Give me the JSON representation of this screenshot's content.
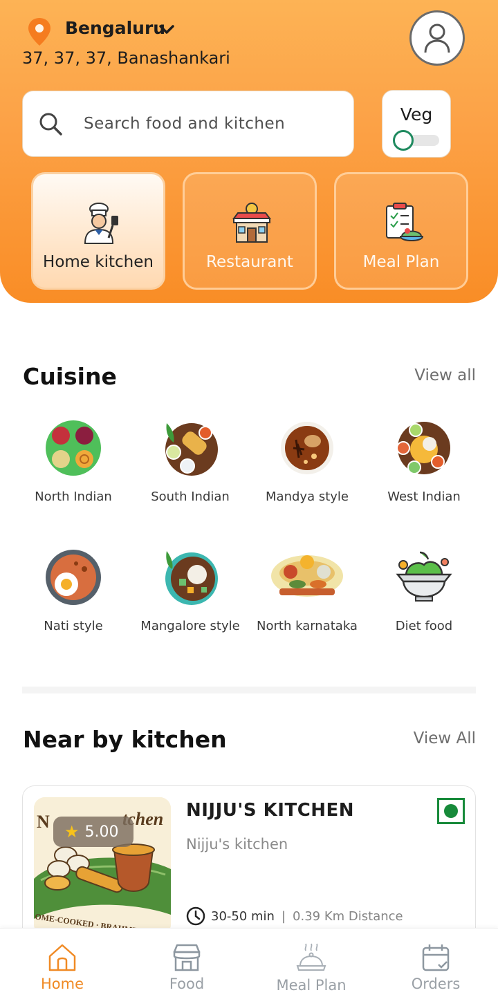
{
  "location": {
    "city": "Bengaluru",
    "address": "37, 37, 37, Banashankari"
  },
  "search": {
    "placeholder": "Search food and kitchen"
  },
  "veg_toggle": {
    "label": "Veg",
    "on": false
  },
  "categories": [
    {
      "label": "Home kitchen",
      "icon": "chef-icon",
      "active": true
    },
    {
      "label": "Restaurant",
      "icon": "restaurant-icon",
      "active": false
    },
    {
      "label": "Meal Plan",
      "icon": "meal-plan-icon",
      "active": false
    }
  ],
  "cuisine": {
    "title": "Cuisine",
    "view_all": "View all",
    "items": [
      {
        "label": "North Indian"
      },
      {
        "label": "South Indian"
      },
      {
        "label": "Mandya style"
      },
      {
        "label": "West Indian"
      },
      {
        "label": "Nati style"
      },
      {
        "label": "Mangalore style"
      },
      {
        "label": "North karnataka"
      },
      {
        "label": "Diet food"
      }
    ]
  },
  "nearby": {
    "title": "Near by kitchen",
    "view_all": "View All",
    "kitchens": [
      {
        "name": "NIJJU'S KITCHEN",
        "subtitle": "Nijju's kitchen",
        "rating": "5.00",
        "time": "30-50 min",
        "distance": "0.39 Km Distance",
        "veg": true
      }
    ]
  },
  "bottom_nav": [
    {
      "label": "Home",
      "icon": "home-icon",
      "active": true
    },
    {
      "label": "Food",
      "icon": "store-icon",
      "active": false
    },
    {
      "label": "Meal Plan",
      "icon": "cloche-icon",
      "active": false
    },
    {
      "label": "Orders",
      "icon": "calendar-icon",
      "active": false
    }
  ],
  "colors": {
    "accent": "#f08a24",
    "header_gradient_top": "#fdb355",
    "header_gradient_bottom": "#f98d26",
    "veg_green": "#178a3a"
  }
}
